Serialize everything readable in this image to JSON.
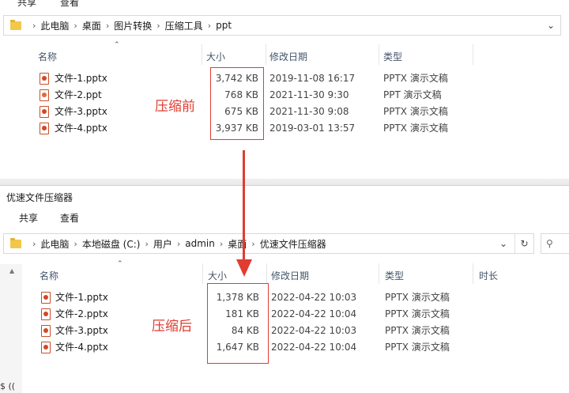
{
  "top_window": {
    "menu_tabs": [
      "共享",
      "查看"
    ],
    "breadcrumb": [
      "此电脑",
      "桌面",
      "图片转换",
      "压缩工具",
      "ppt"
    ],
    "columns": {
      "name": "名称",
      "size": "大小",
      "modified": "修改日期",
      "type": "类型"
    },
    "files": [
      {
        "name": "文件-1.pptx",
        "size": "3,742 KB",
        "modified": "2019-11-08 16:17",
        "type": "PPTX 演示文稿"
      },
      {
        "name": "文件-2.ppt",
        "size": "768 KB",
        "modified": "2021-11-30 9:30",
        "type": "PPT 演示文稿"
      },
      {
        "name": "文件-3.pptx",
        "size": "675 KB",
        "modified": "2021-11-30 9:08",
        "type": "PPTX 演示文稿"
      },
      {
        "name": "文件-4.pptx",
        "size": "3,937 KB",
        "modified": "2019-03-01 13:57",
        "type": "PPTX 演示文稿"
      }
    ],
    "annotation": "压缩前"
  },
  "bottom_window": {
    "title": "优速文件压缩器",
    "menu_tabs": [
      "共享",
      "查看"
    ],
    "breadcrumb": [
      "此电脑",
      "本地磁盘 (C:)",
      "用户",
      "admin",
      "桌面",
      "优速文件压缩器"
    ],
    "columns": {
      "name": "名称",
      "size": "大小",
      "modified": "修改日期",
      "type": "类型",
      "duration": "时长"
    },
    "files": [
      {
        "name": "文件-1.pptx",
        "size": "1,378 KB",
        "modified": "2022-04-22 10:03",
        "type": "PPTX 演示文稿"
      },
      {
        "name": "文件-2.pptx",
        "size": "181 KB",
        "modified": "2022-04-22 10:04",
        "type": "PPTX 演示文稿"
      },
      {
        "name": "文件-3.pptx",
        "size": "84 KB",
        "modified": "2022-04-22 10:03",
        "type": "PPTX 演示文稿"
      },
      {
        "name": "文件-4.pptx",
        "size": "1,647 KB",
        "modified": "2022-04-22 10:04",
        "type": "PPTX 演示文稿"
      }
    ],
    "annotation": "压缩后",
    "status_fragment": "$ (("
  },
  "colors": {
    "annotation_red": "#e03c31",
    "folder_yellow": "#f2c84b",
    "ppt_orange": "#d24726"
  },
  "icons": [
    "folder-icon",
    "chevron-right-icon",
    "chevron-down-icon",
    "refresh-icon",
    "search-icon",
    "pptx-file-icon",
    "ppt-file-icon",
    "sort-up-icon",
    "arrow-down-annotation"
  ]
}
